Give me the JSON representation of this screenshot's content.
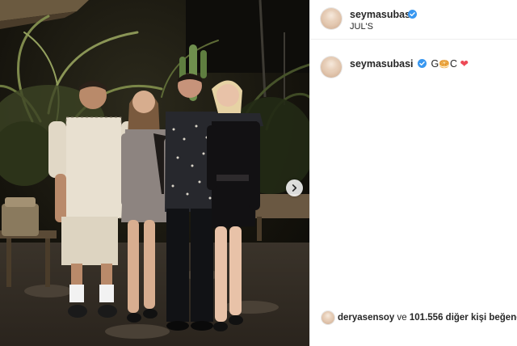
{
  "post": {
    "username": "seymasubasi",
    "location": "JUL'S"
  },
  "caption": {
    "username": "seymasubasi",
    "text_prefix": "G",
    "emoji": "🥯",
    "text_suffix": "C",
    "heart": "❤"
  },
  "likes": {
    "first_user": "deryasensoy",
    "connector": "ve",
    "count": "101.556",
    "suffix": "diğer kişi beğendi"
  },
  "icons": {
    "verified": "verified-badge-icon",
    "next": "chevron-right-icon"
  },
  "colors": {
    "verified_blue": "#3897f0",
    "heart_red": "#ed4956",
    "text": "#262626"
  }
}
